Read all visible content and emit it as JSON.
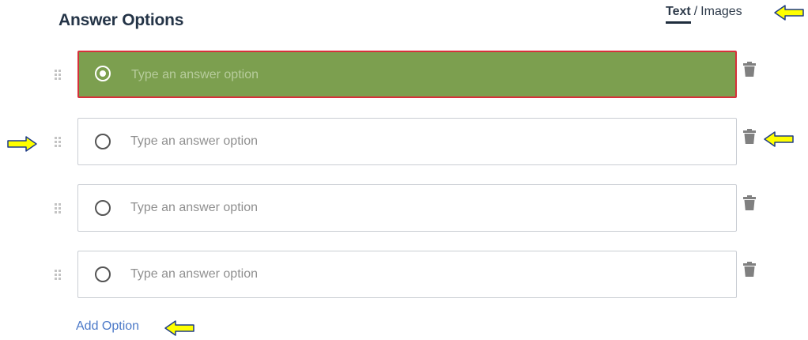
{
  "header": {
    "title": "Answer Options",
    "mode_text": "Text",
    "mode_separator": "/",
    "mode_images": "Images"
  },
  "options": [
    {
      "placeholder": "Type an answer option",
      "selected": true
    },
    {
      "placeholder": "Type an answer option",
      "selected": false
    },
    {
      "placeholder": "Type an answer option",
      "selected": false
    },
    {
      "placeholder": "Type an answer option",
      "selected": false
    }
  ],
  "add_option_label": "Add Option",
  "icons": {
    "drag": "drag-handle-icon",
    "radio": "radio-icon",
    "delete": "trash-icon",
    "annotation": "arrow-icon"
  },
  "colors": {
    "selected_bg": "#7c9f4f",
    "selected_border": "#d7303b",
    "link": "#4b79c8",
    "arrow_fill": "#ffff00",
    "arrow_stroke": "#1f3c88"
  }
}
